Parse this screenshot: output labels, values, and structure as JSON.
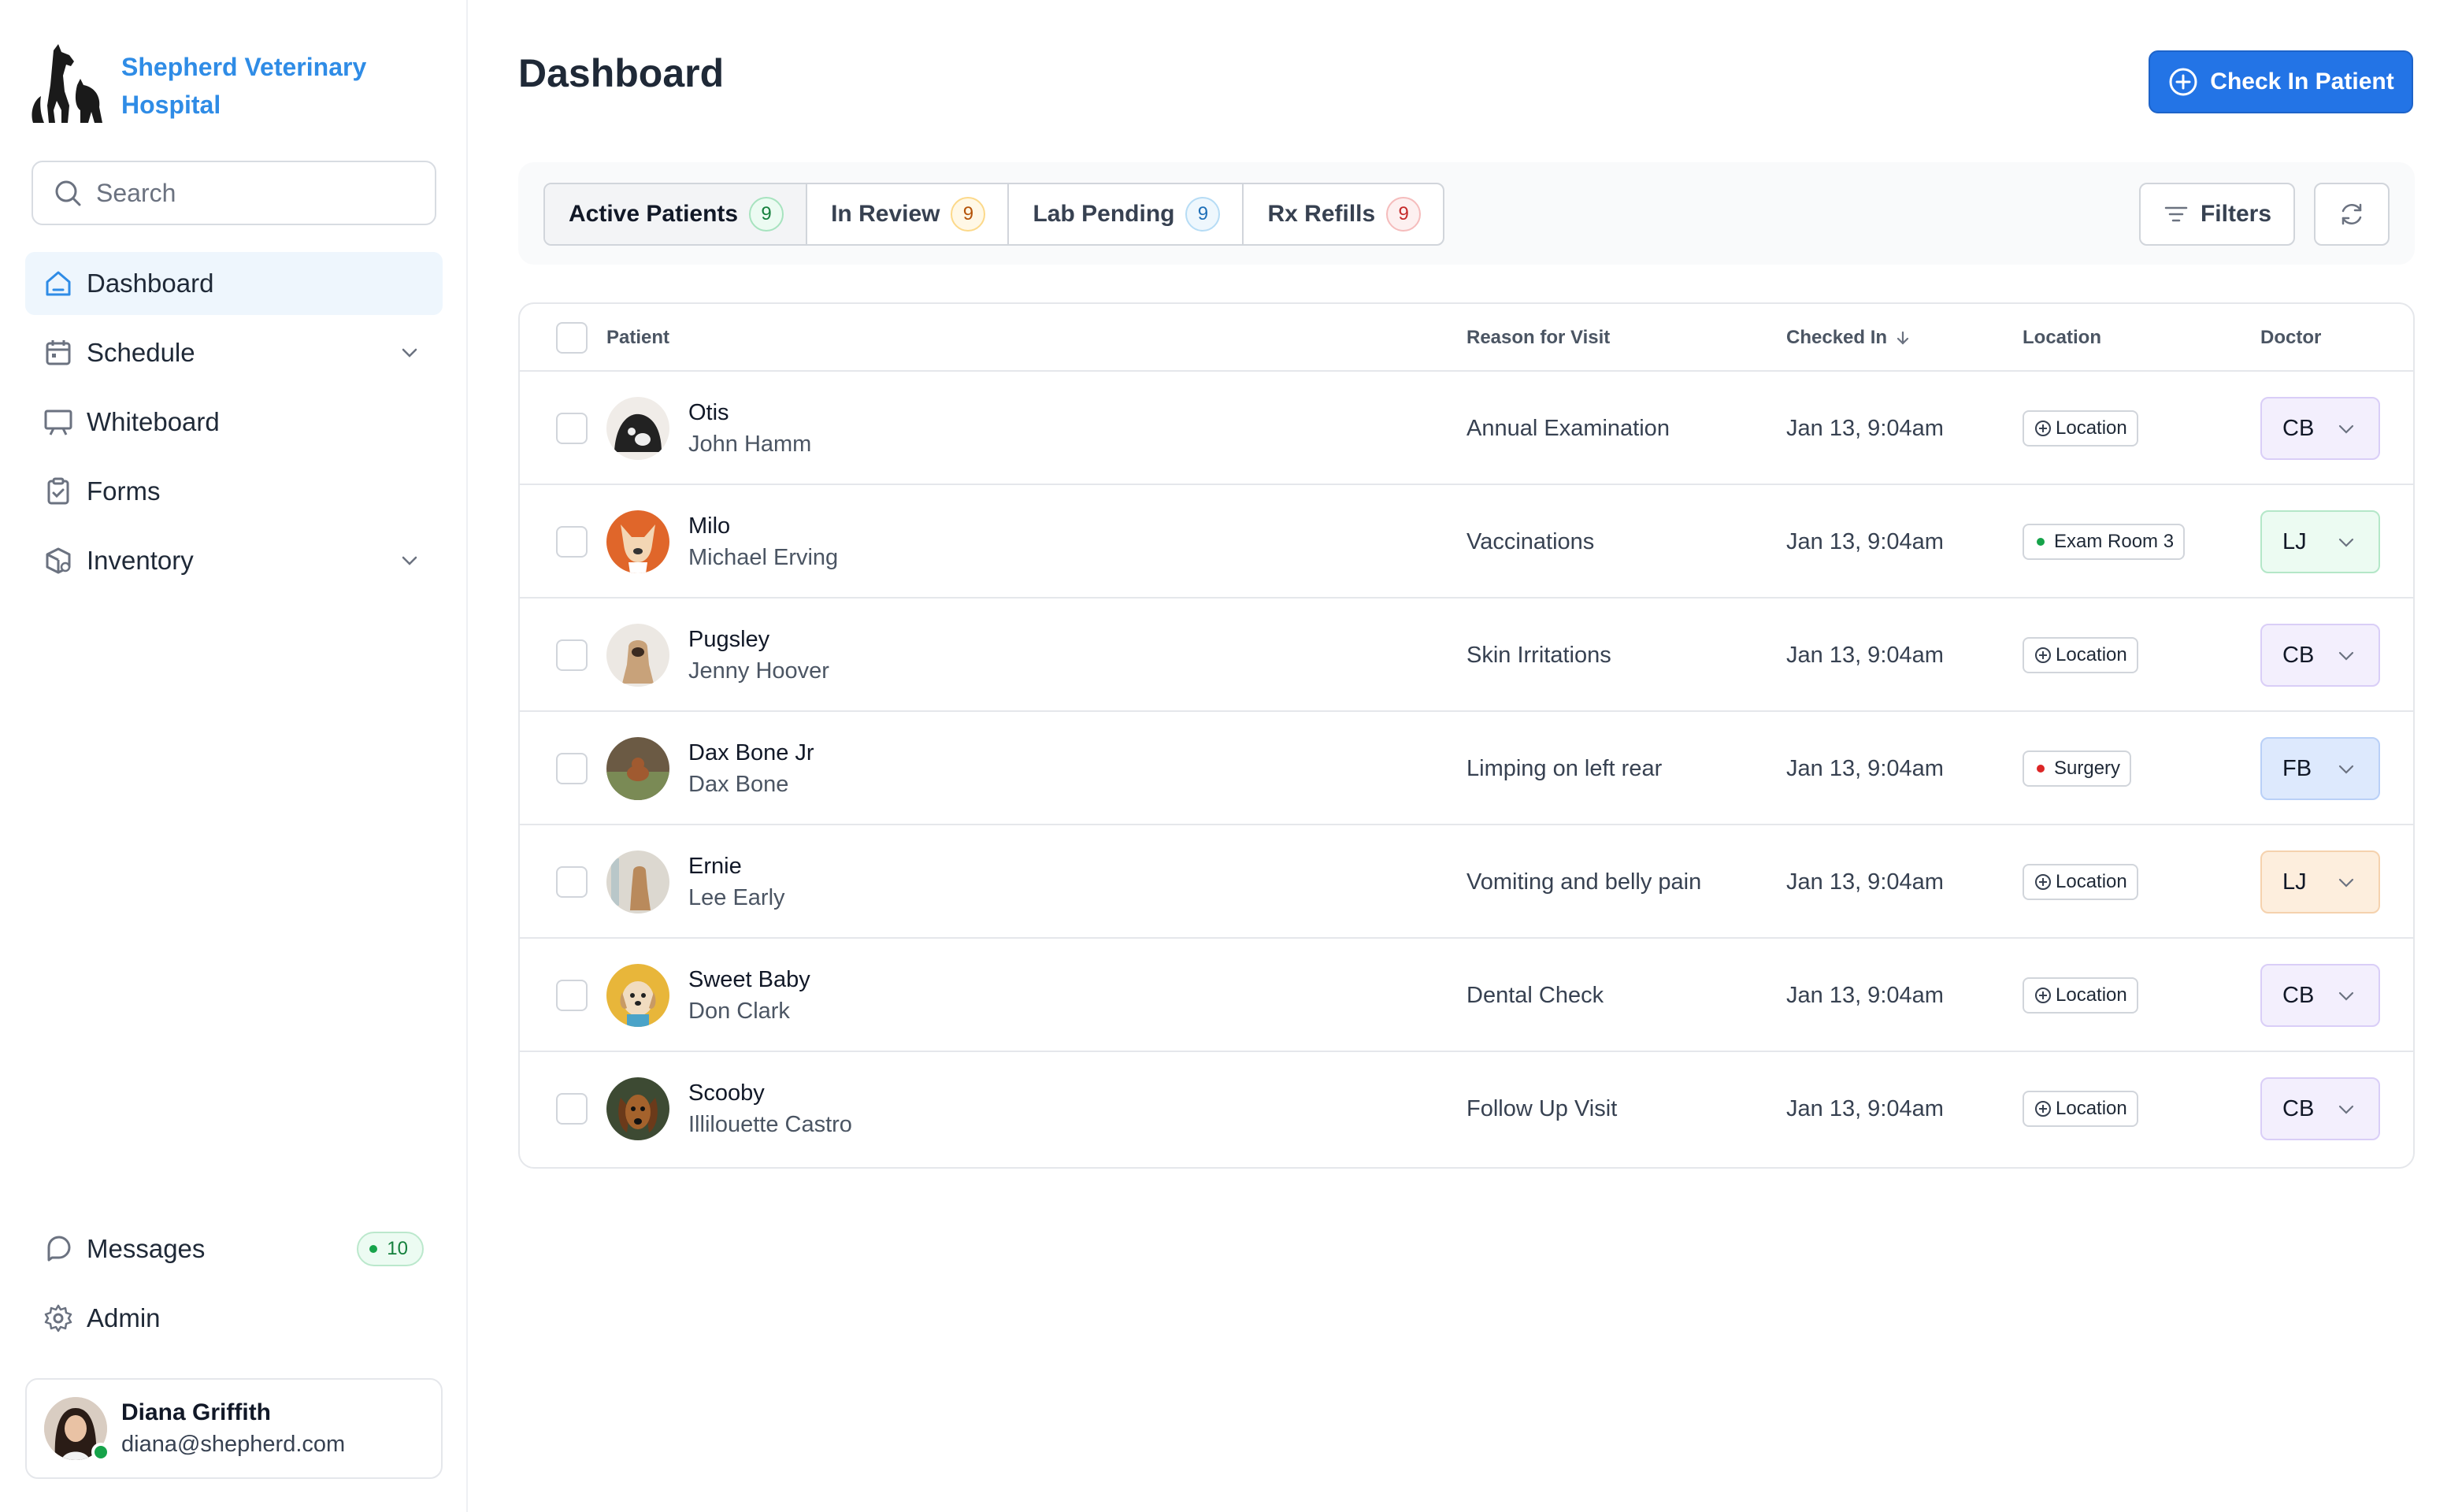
{
  "brand": {
    "name_line1": "Shepherd Veterinary",
    "name_line2": "Hospital"
  },
  "search": {
    "placeholder": "Search"
  },
  "nav": [
    {
      "label": "Dashboard",
      "icon": "home-icon",
      "active": true
    },
    {
      "label": "Schedule",
      "icon": "calendar-icon",
      "expandable": true
    },
    {
      "label": "Whiteboard",
      "icon": "presentation-icon"
    },
    {
      "label": "Forms",
      "icon": "clipboard-check-icon"
    },
    {
      "label": "Inventory",
      "icon": "box-search-icon",
      "expandable": true
    }
  ],
  "bottom_nav": {
    "messages": {
      "label": "Messages",
      "badge": "10",
      "icon": "chat-bubble-icon"
    },
    "admin": {
      "label": "Admin",
      "icon": "gear-icon"
    }
  },
  "user": {
    "name": "Diana Griffith",
    "email": "diana@shepherd.com",
    "status": "online"
  },
  "header": {
    "title": "Dashboard",
    "check_in_label": "Check In Patient"
  },
  "tabs": [
    {
      "label": "Active Patients",
      "count": "9",
      "tone": "green",
      "active": true
    },
    {
      "label": "In Review",
      "count": "9",
      "tone": "amber"
    },
    {
      "label": "Lab Pending",
      "count": "9",
      "tone": "blue"
    },
    {
      "label": "Rx Refills",
      "count": "9",
      "tone": "red"
    }
  ],
  "toolbar": {
    "filters_label": "Filters"
  },
  "table": {
    "headers": {
      "patient": "Patient",
      "reason": "Reason for Visit",
      "checked_in": "Checked In",
      "location": "Location",
      "doctor": "Doctor"
    },
    "rows": [
      {
        "pet": "Otis",
        "owner": "John Hamm",
        "reason": "Annual Examination",
        "checked_in": "Jan 13, 9:04am",
        "location": "Location",
        "location_type": "add",
        "doctor": "CB",
        "doctor_color": "#f3effd",
        "doctor_border": "#d9cef7",
        "avatar_bg": "#3a3a3a"
      },
      {
        "pet": "Milo",
        "owner": "Michael Erving",
        "reason": "Vaccinations",
        "checked_in": "Jan 13, 9:04am",
        "location": "Exam Room 3",
        "location_type": "status",
        "location_dot": "#16a34a",
        "doctor": "LJ",
        "doctor_color": "#ecfbf2",
        "doctor_border": "#b4e7c8",
        "avatar_bg": "#e0662a"
      },
      {
        "pet": "Pugsley",
        "owner": "Jenny Hoover",
        "reason": "Skin Irritations",
        "checked_in": "Jan 13, 9:04am",
        "location": "Location",
        "location_type": "add",
        "doctor": "CB",
        "doctor_color": "#f3effd",
        "doctor_border": "#d9cef7",
        "avatar_bg": "#ece8e3"
      },
      {
        "pet": "Dax Bone Jr",
        "owner": "Dax Bone",
        "reason": "Limping on left rear",
        "checked_in": "Jan 13, 9:04am",
        "location": "Surgery",
        "location_type": "status",
        "location_dot": "#dc2626",
        "doctor": "FB",
        "doctor_color": "#dde9fd",
        "doctor_border": "#b9d0f7",
        "avatar_bg": "#6b5a44"
      },
      {
        "pet": "Ernie",
        "owner": "Lee Early",
        "reason": "Vomiting and belly pain",
        "checked_in": "Jan 13, 9:04am",
        "location": "Location",
        "location_type": "add",
        "doctor": "LJ",
        "doctor_color": "#fdeedd",
        "doctor_border": "#f5d2ae",
        "avatar_bg": "#dcd8d0"
      },
      {
        "pet": "Sweet Baby",
        "owner": "Don Clark",
        "reason": "Dental Check",
        "checked_in": "Jan 13, 9:04am",
        "location": "Location",
        "location_type": "add",
        "doctor": "CB",
        "doctor_color": "#f3effd",
        "doctor_border": "#d9cef7",
        "avatar_bg": "#e8b63a"
      },
      {
        "pet": "Scooby",
        "owner": "Illilouette Castro",
        "reason": "Follow Up Visit",
        "checked_in": "Jan 13, 9:04am",
        "location": "Location",
        "location_type": "add",
        "doctor": "CB",
        "doctor_color": "#f3effd",
        "doctor_border": "#d9cef7",
        "avatar_bg": "#3d4a33"
      }
    ]
  },
  "colors": {
    "accent": "#2374e6",
    "brand": "#2f8ce6",
    "active_nav_bg": "#eef6fd"
  }
}
